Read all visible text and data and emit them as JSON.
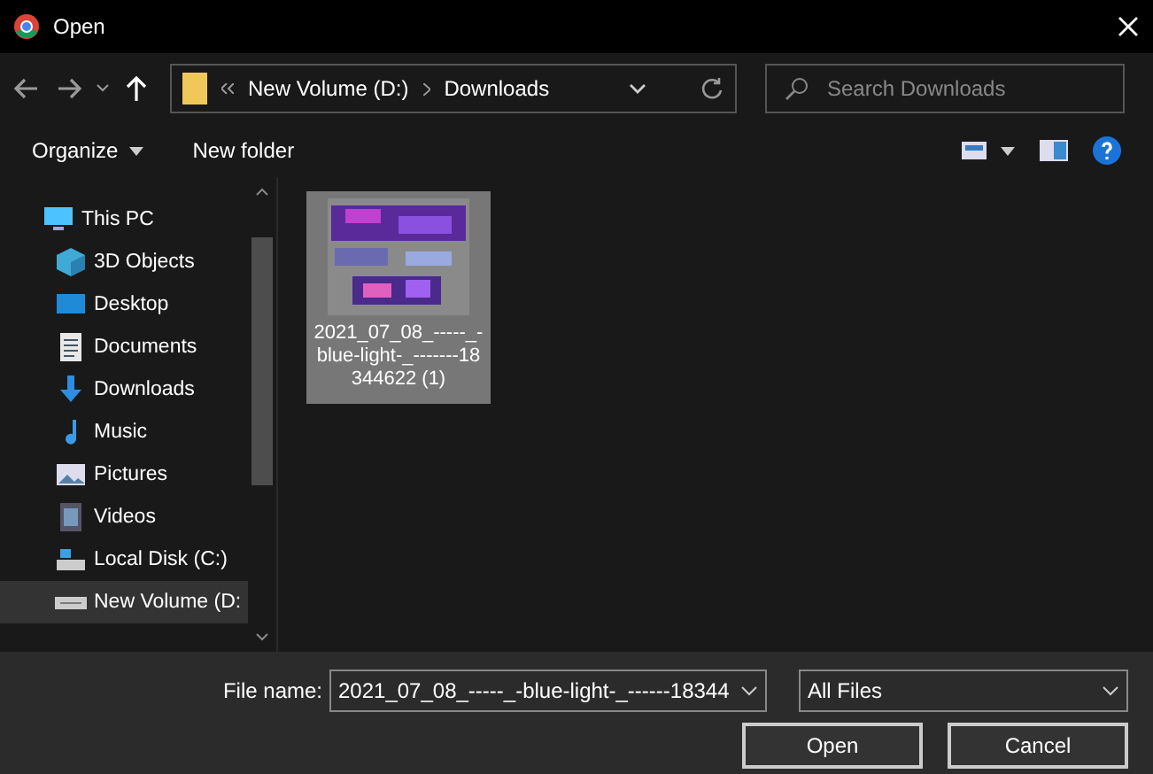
{
  "window": {
    "title": "Open"
  },
  "address": {
    "crumbs": [
      "New Volume (D:)",
      "Downloads"
    ]
  },
  "search": {
    "placeholder": "Search Downloads"
  },
  "toolbar": {
    "organize": "Organize",
    "new_folder": "New folder"
  },
  "sidebar": {
    "items": [
      {
        "label": "This PC",
        "kind": "pc",
        "selected": false,
        "children": [
          {
            "label": "3D Objects",
            "kind": "cube",
            "selected": false
          },
          {
            "label": "Desktop",
            "kind": "desktop",
            "selected": false
          },
          {
            "label": "Documents",
            "kind": "doc",
            "selected": false
          },
          {
            "label": "Downloads",
            "kind": "download",
            "selected": false
          },
          {
            "label": "Music",
            "kind": "music",
            "selected": false
          },
          {
            "label": "Pictures",
            "kind": "pictures",
            "selected": false
          },
          {
            "label": "Videos",
            "kind": "videos",
            "selected": false
          },
          {
            "label": "Local Disk (C:)",
            "kind": "disk",
            "selected": false
          },
          {
            "label": "New Volume (D:",
            "kind": "drive",
            "selected": true
          }
        ]
      }
    ]
  },
  "files": [
    {
      "name": "2021_07_08_-----_-blue-light-_-----​--18344622 (1)",
      "kind": "picture",
      "selected": true
    }
  ],
  "footer": {
    "file_name_label": "File name:",
    "file_name": "2021_07_08_-----_-blue-light-_------18344",
    "filter": "All Files",
    "buttons": [
      "Open",
      "Cancel"
    ]
  }
}
